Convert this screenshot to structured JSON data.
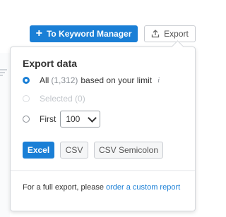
{
  "toolbar": {
    "keyword_manager_label": "To Keyword Manager",
    "export_label": "Export"
  },
  "popup": {
    "title": "Export data",
    "options": {
      "all_label": "All",
      "all_count": "(1,312)",
      "all_suffix": "based on your limit",
      "info_symbol": "i",
      "selected_label": "Selected (0)",
      "first_label": "First",
      "first_value": "100"
    },
    "buttons": {
      "excel": "Excel",
      "csv": "CSV",
      "csv_semicolon": "CSV Semicolon"
    },
    "footer": {
      "text": "For a full export, please",
      "link": "order a custom report"
    }
  },
  "colors": {
    "accent": "#1a7fd6",
    "border": "#c9ccd1"
  }
}
